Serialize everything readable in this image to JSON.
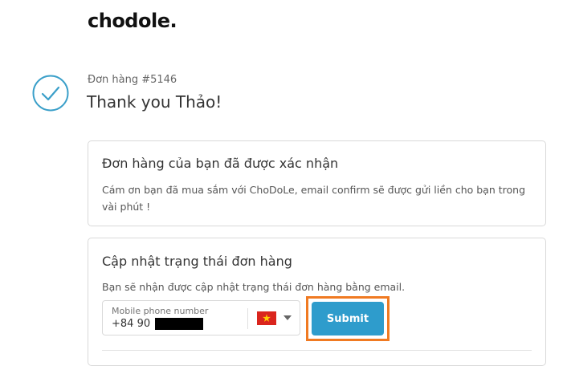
{
  "brand": {
    "logo": "chodole."
  },
  "order": {
    "number": "Đơn hàng #5146",
    "thanks": "Thank you Thảo!"
  },
  "confirmation": {
    "title": "Đơn hàng của bạn đã được xác nhận",
    "text": "Cám ơn bạn đã mua sắm với ChoDoLe, email confirm sẽ được gửi liền cho bạn trong vài phút !"
  },
  "status_update": {
    "title": "Cập nhật trạng thái đơn hàng",
    "text": "Bạn sẽ nhận được cập nhật trạng thái đơn hàng bằng email.",
    "phone_placeholder": "Mobile phone number",
    "phone_value": "+84 90",
    "country_flag": "vietnam-flag-icon",
    "submit_label": "Submit"
  },
  "colors": {
    "accent": "#2e9ccc",
    "highlight_outline": "#f07a22",
    "check_circle": "#3a9fc9",
    "flag_red": "#da251d",
    "flag_star": "#ffcd00"
  }
}
